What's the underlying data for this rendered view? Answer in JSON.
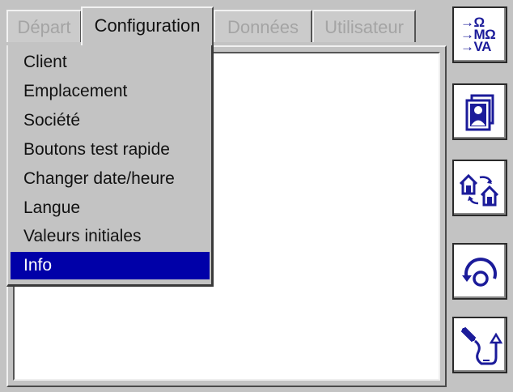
{
  "tabs": [
    {
      "label": "Départ",
      "active": false
    },
    {
      "label": "Configuration",
      "active": true
    },
    {
      "label": "Données",
      "active": false
    },
    {
      "label": "Utilisateur",
      "active": false
    }
  ],
  "menu": {
    "items": [
      {
        "label": "Client"
      },
      {
        "label": "Emplacement"
      },
      {
        "label": "Société"
      },
      {
        "label": "Boutons test rapide"
      },
      {
        "label": "Changer date/heure"
      },
      {
        "label": "Langue"
      },
      {
        "label": "Valeurs initiales"
      },
      {
        "label": "Info"
      }
    ],
    "selected": "Info"
  },
  "side_buttons": {
    "measure": {
      "icon": "measure-units-icon",
      "lines": [
        "→Ω",
        "→MΩ",
        "→VA"
      ]
    },
    "profile": {
      "icon": "user-profile-icon"
    },
    "transfer": {
      "icon": "house-transfer-icon"
    },
    "rotate": {
      "icon": "rotate-icon"
    },
    "probe": {
      "icon": "probe-icon"
    }
  },
  "colors": {
    "selection": "#0000a8",
    "icon_blue": "#1b1b9a",
    "panel_gray": "#c3c3c3"
  }
}
